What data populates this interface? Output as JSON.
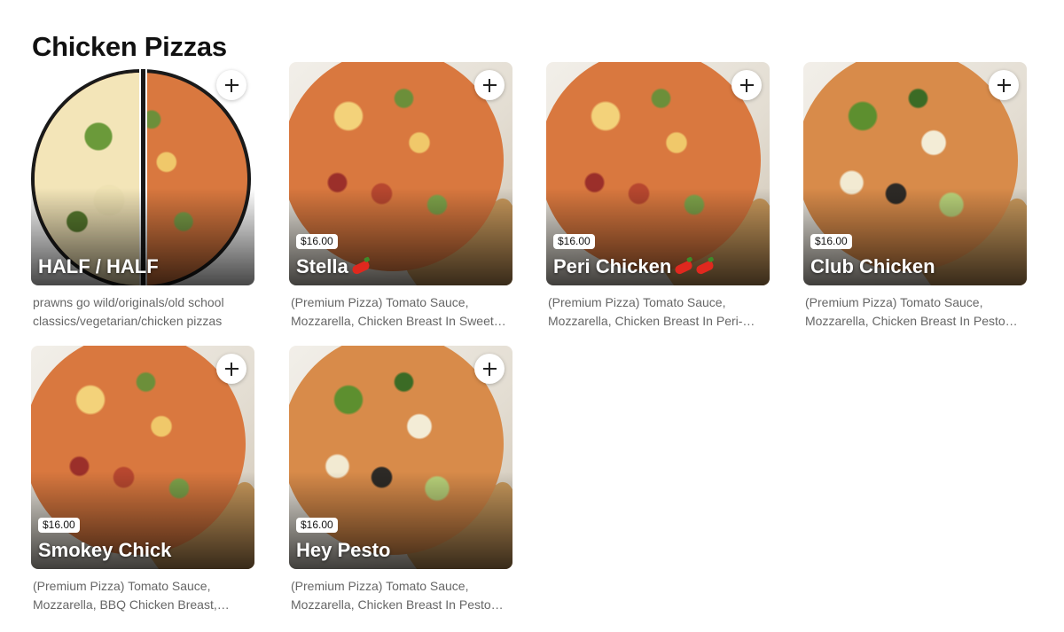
{
  "section": {
    "title": "Chicken Pizzas"
  },
  "colors": {
    "chili": "#e0281e",
    "badge_bg": "#ffffff",
    "name_text": "#ffffff"
  },
  "items": [
    {
      "name": "HALF / HALF",
      "price": "",
      "description": "prawns go wild/originals/old school classics/vegetarian/chicken pizzas",
      "spicy_icons": 0
    },
    {
      "name": "Stella",
      "price": "$16.00",
      "description": "(Premium Pizza) Tomato Sauce, Mozzarella, Chicken Breast In Sweet Chilli…",
      "spicy_icons": 1
    },
    {
      "name": "Peri Chicken",
      "price": "$16.00",
      "description": "(Premium Pizza) Tomato Sauce, Mozzarella, Chicken Breast In Peri-Peri…",
      "spicy_icons": 2
    },
    {
      "name": "Club Chicken",
      "price": "$16.00",
      "description": "(Premium Pizza) Tomato Sauce, Mozzarella, Chicken Breast In Pesto…",
      "spicy_icons": 0
    },
    {
      "name": "Smokey Chick",
      "price": "$16.00",
      "description": "(Premium Pizza) Tomato Sauce, Mozzarella, BBQ Chicken Breast,…",
      "spicy_icons": 0
    },
    {
      "name": "Hey Pesto",
      "price": "$16.00",
      "description": "(Premium Pizza) Tomato Sauce, Mozzarella, Chicken Breast In Pesto…",
      "spicy_icons": 0
    }
  ]
}
